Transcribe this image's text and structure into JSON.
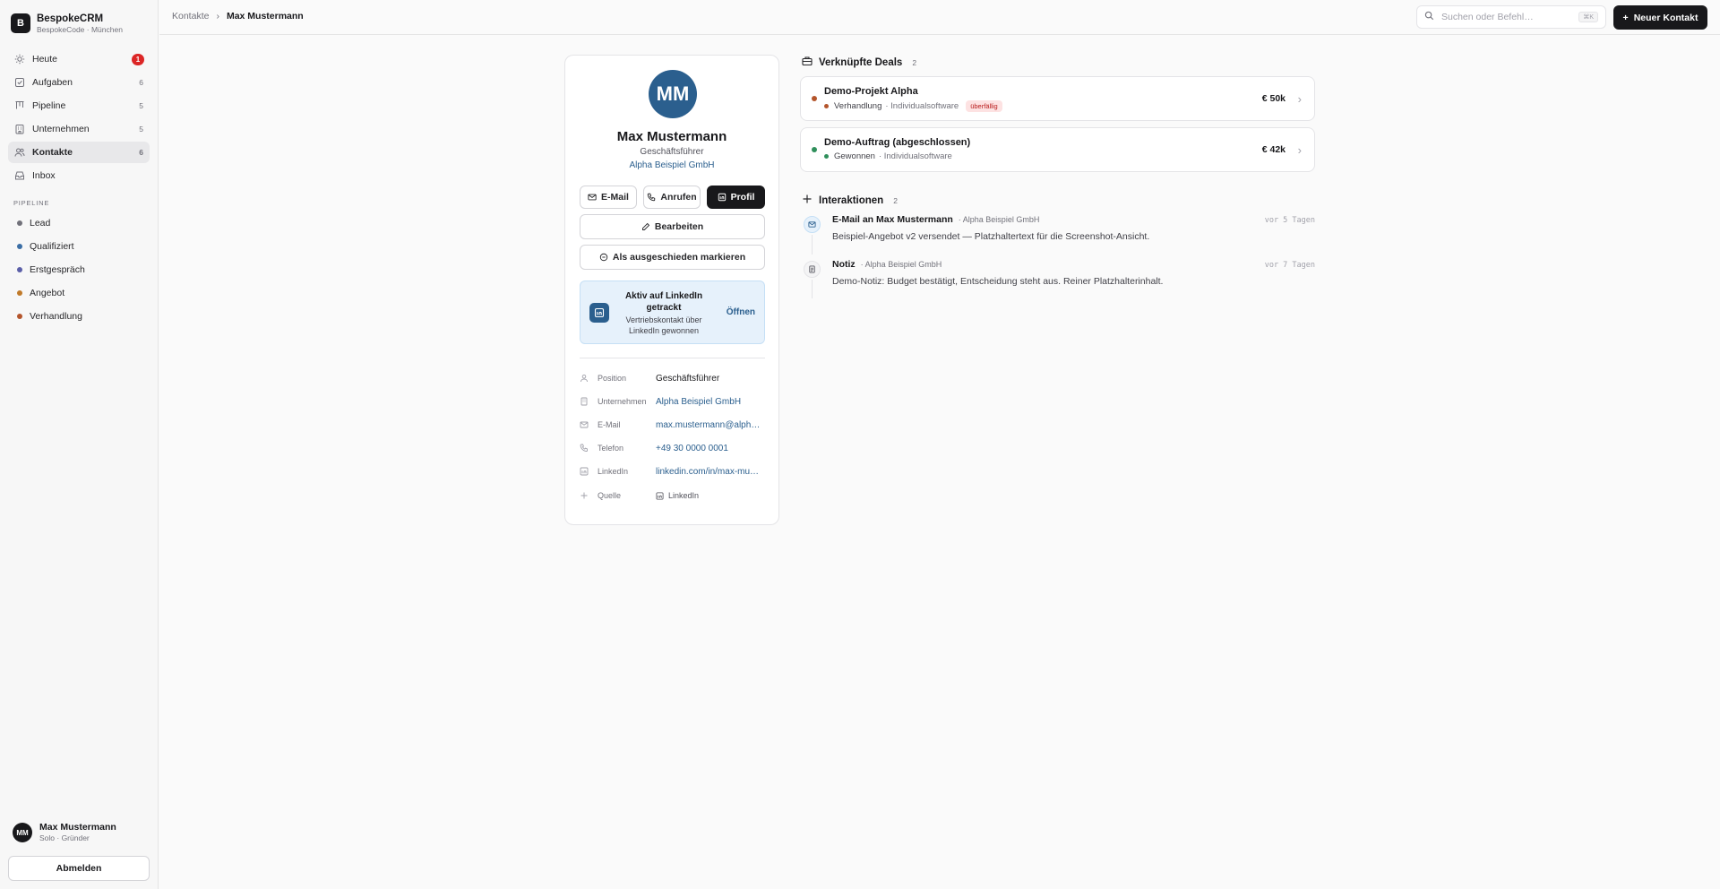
{
  "brand": {
    "logo_letter": "B",
    "name": "BespokeCRM",
    "subtitle": "BespokeCode · München"
  },
  "nav": [
    {
      "label": "Heute",
      "icon": "sun-icon",
      "badge": "1"
    },
    {
      "label": "Aufgaben",
      "icon": "checkbox-icon",
      "count": "6"
    },
    {
      "label": "Pipeline",
      "icon": "kanban-icon",
      "count": "5"
    },
    {
      "label": "Unternehmen",
      "icon": "building-icon",
      "count": "5"
    },
    {
      "label": "Kontakte",
      "icon": "users-icon",
      "count": "6",
      "active": true
    },
    {
      "label": "Inbox",
      "icon": "inbox-icon"
    }
  ],
  "pipeline_section_label": "PIPELINE",
  "pipeline": [
    {
      "label": "Lead",
      "color": "#71717a"
    },
    {
      "label": "Qualifiziert",
      "color": "#3b6ea5"
    },
    {
      "label": "Erstgespräch",
      "color": "#5b5fa8"
    },
    {
      "label": "Angebot",
      "color": "#c07a2a"
    },
    {
      "label": "Verhandlung",
      "color": "#b4552c"
    }
  ],
  "user": {
    "initials": "MM",
    "name": "Max Mustermann",
    "role": "Solo · Gründer"
  },
  "logout_label": "Abmelden",
  "header": {
    "breadcrumb_parent": "Kontakte",
    "breadcrumb_current": "Max Mustermann",
    "search_placeholder": "Suchen oder Befehl…",
    "search_shortcut": "⌘K",
    "new_contact_label": "Neuer Kontakt"
  },
  "profile": {
    "initials": "MM",
    "name": "Max Mustermann",
    "role": "Geschäftsführer",
    "company": "Alpha Beispiel GmbH",
    "email_btn": "E-Mail",
    "call_btn": "Anrufen",
    "profile_btn": "Profil",
    "edit_btn": "Bearbeiten",
    "retire_btn": "Als ausgeschieden markieren",
    "linkedin_card": {
      "title": "Aktiv auf LinkedIn getrackt",
      "desc": "Vertriebskontakt über LinkedIn gewonnen",
      "open": "Öffnen"
    },
    "fields": [
      {
        "label": "Position",
        "value": "Geschäftsführer",
        "icon": "person-icon",
        "link": false
      },
      {
        "label": "Unternehmen",
        "value": "Alpha Beispiel GmbH",
        "icon": "building-icon",
        "link": true
      },
      {
        "label": "E-Mail",
        "value": "max.mustermann@alpha…",
        "icon": "mail-icon",
        "link": true
      },
      {
        "label": "Telefon",
        "value": "+49 30 0000 0001",
        "icon": "phone-icon",
        "link": true
      },
      {
        "label": "LinkedIn",
        "value": "linkedin.com/in/max-mu…",
        "icon": "linkedin-icon",
        "link": true
      },
      {
        "label": "Quelle",
        "value": "LinkedIn",
        "icon": "plus-icon",
        "link": false
      }
    ]
  },
  "deals": {
    "title": "Verknüpfte Deals",
    "count": "2",
    "items": [
      {
        "name": "Demo-Projekt Alpha",
        "stage": "Verhandlung",
        "type": "· Individualsoftware",
        "tag": "überfällig",
        "amount": "€  50k",
        "dot": "#b4552c",
        "stage_dot": "#b4552c"
      },
      {
        "name": "Demo-Auftrag (abgeschlossen)",
        "stage": "Gewonnen",
        "type": "· Individualsoftware",
        "tag": "",
        "amount": "€  42k",
        "dot": "#2f8f5b",
        "stage_dot": "#2f8f5b"
      }
    ]
  },
  "interactions": {
    "title": "Interaktionen",
    "count": "2",
    "items": [
      {
        "title": "E-Mail an Max Mustermann",
        "company": "· Alpha Beispiel GmbH",
        "time": "vor 5 Tagen",
        "body": "Beispiel-Angebot v2 versendet — Platzhaltertext für die Screenshot-Ansicht.",
        "icon": "mail-icon"
      },
      {
        "title": "Notiz",
        "company": "· Alpha Beispiel GmbH",
        "time": "vor 7 Tagen",
        "body": "Demo-Notiz: Budget bestätigt, Entscheidung steht aus. Reiner Platzhalterinhalt.",
        "icon": "note-icon"
      }
    ]
  }
}
